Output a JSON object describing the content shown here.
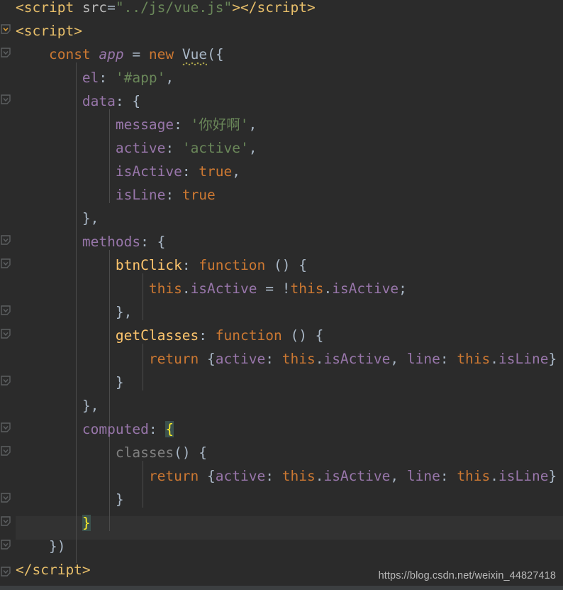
{
  "editor": {
    "theme_name": "darcula",
    "background_color": "#2b2b2b",
    "current_line_color": "#323232",
    "indent_guide_color": "#4b4b4b",
    "default_text_color": "#a9b7c6",
    "brace_match_bg_color": "#3b514d",
    "brace_match_fg_color": "#ffef28"
  },
  "code": {
    "language": "html-vue-javascript",
    "lines": [
      {
        "n": 1,
        "text": "<script src=\"../js/vue.js\"></script>"
      },
      {
        "n": 2,
        "text": "<script>"
      },
      {
        "n": 3,
        "text": "    const app = new Vue({"
      },
      {
        "n": 4,
        "text": "        el: '#app',"
      },
      {
        "n": 5,
        "text": "        data: {"
      },
      {
        "n": 6,
        "text": "            message: '你好啊',"
      },
      {
        "n": 7,
        "text": "            active: 'active',"
      },
      {
        "n": 8,
        "text": "            isActive: true,"
      },
      {
        "n": 9,
        "text": "            isLine: true"
      },
      {
        "n": 10,
        "text": "        },"
      },
      {
        "n": 11,
        "text": "        methods: {"
      },
      {
        "n": 12,
        "text": "            btnClick: function () {"
      },
      {
        "n": 13,
        "text": "                this.isActive = !this.isActive;"
      },
      {
        "n": 14,
        "text": "            },"
      },
      {
        "n": 15,
        "text": "            getClasses: function () {"
      },
      {
        "n": 16,
        "text": "                return {active: this.isActive, line: this.isLine}"
      },
      {
        "n": 17,
        "text": "            }"
      },
      {
        "n": 18,
        "text": "        },"
      },
      {
        "n": 19,
        "text": "        computed: {"
      },
      {
        "n": 20,
        "text": "            classes() {"
      },
      {
        "n": 21,
        "text": "                return {active: this.isActive, line: this.isLine}"
      },
      {
        "n": 22,
        "text": "            }"
      },
      {
        "n": 23,
        "text": "        }"
      },
      {
        "n": 24,
        "text": "    })"
      },
      {
        "n": 25,
        "text": "</script>"
      }
    ],
    "tokens": {
      "script_open_tag": "<script",
      "script_close_tag": "</script>",
      "attr_src": "src",
      "attr_src_value": "\"../js/vue.js\"",
      "kw_const": "const",
      "ident_app": "app",
      "kw_new": "new",
      "ident_vue": "Vue",
      "prop_el": "el",
      "val_el": "'#app'",
      "prop_data": "data",
      "prop_message": "message",
      "val_message": "'你好啊'",
      "prop_active": "active",
      "val_active": "'active'",
      "prop_isActive": "isActive",
      "prop_isLine": "isLine",
      "kw_true": "true",
      "prop_methods": "methods",
      "fn_btnClick": "btnClick",
      "kw_function": "function",
      "kw_this": "this",
      "fn_getClasses": "getClasses",
      "kw_return": "return",
      "prop_line": "line",
      "prop_computed": "computed",
      "fn_classes": "classes"
    }
  },
  "gutter": {
    "fold_marker_icon": "fold-arrow-icon",
    "fold_marker_color": "#606366",
    "markers_on_lines": [
      2,
      3,
      5,
      11,
      12,
      15,
      16,
      19,
      20,
      21,
      23,
      24,
      25
    ]
  },
  "watermark": {
    "text": "https://blog.csdn.net/weixin_44827418"
  },
  "selection": {
    "current_line_number": 23,
    "matched_brace_open_line": 19,
    "matched_brace_open_char": "{",
    "matched_brace_close_line": 23,
    "matched_brace_close_char": "}"
  }
}
